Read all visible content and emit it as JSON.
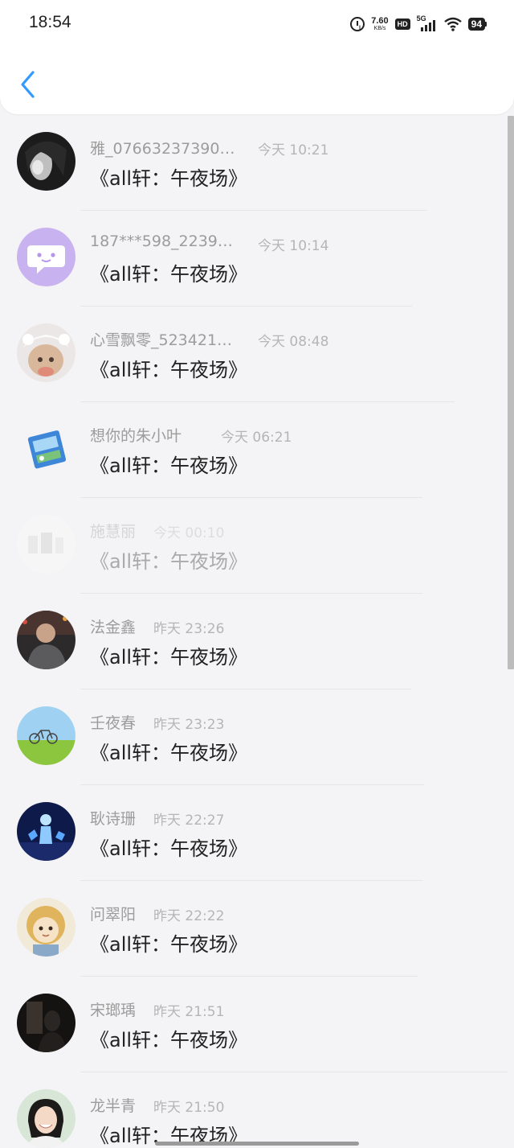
{
  "status_bar": {
    "time": "18:54",
    "net_speed": "7.60",
    "net_unit": "KB/s",
    "hd_label": "HD",
    "network_type": "5G",
    "battery": "94"
  },
  "header": {
    "back_icon": "chevron-left-icon",
    "accent_color": "#2f9bff"
  },
  "list": [
    {
      "name": "雅_07663237390…",
      "time": "今天 10:21",
      "message": "《all轩：午夜场》",
      "avatar": "avatar-dark-portrait"
    },
    {
      "name": "187***598_2239…",
      "time": "今天 10:14",
      "message": "《all轩：午夜场》",
      "avatar": "avatar-purple-chat-bubble"
    },
    {
      "name": "心雪飘零_523421…",
      "time": "今天 08:48",
      "message": "《all轩：午夜场》",
      "avatar": "avatar-white-cat"
    },
    {
      "name": "想你的朱小叶",
      "time": "今天 06:21",
      "message": "《all轩：午夜场》",
      "avatar": "avatar-candy-bag"
    },
    {
      "name": "施慧丽",
      "time": "今天 00:10",
      "message": "《all轩：午夜场》",
      "avatar": "avatar-faded-photo"
    },
    {
      "name": "法金鑫",
      "time": "昨天 23:26",
      "message": "《all轩：午夜场》",
      "avatar": "avatar-man-photo"
    },
    {
      "name": "壬夜春",
      "time": "昨天 23:23",
      "message": "《all轩：午夜场》",
      "avatar": "avatar-bicycle-field"
    },
    {
      "name": "耿诗珊",
      "time": "昨天 22:27",
      "message": "《all轩：午夜场》",
      "avatar": "avatar-blue-figure"
    },
    {
      "name": "问翠阳",
      "time": "昨天 22:22",
      "message": "《all轩：午夜场》",
      "avatar": "avatar-cartoon-lion"
    },
    {
      "name": "宋瑯瑀",
      "time": "昨天 21:51",
      "message": "《all轩：午夜场》",
      "avatar": "avatar-dark-silhouette"
    },
    {
      "name": "龙半青",
      "time": "昨天 21:50",
      "message": "《all轩：午夜场》",
      "avatar": "avatar-girl-smiling"
    }
  ]
}
